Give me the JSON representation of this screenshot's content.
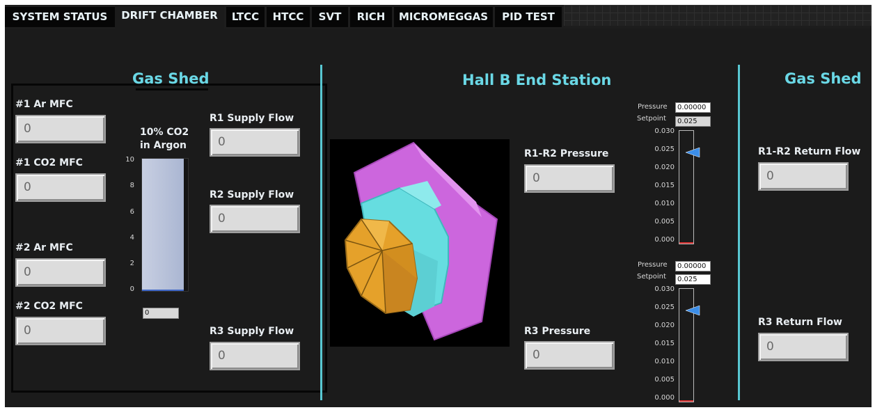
{
  "tabs": [
    "SYSTEM STATUS",
    "DRIFT CHAMBER",
    "LTCC",
    "HTCC",
    "SVT",
    "RICH",
    "MICROMEGGAS",
    "PID TEST"
  ],
  "active_tab": "DRIFT CHAMBER",
  "left_panel": {
    "title": "Gas Shed",
    "mfc": [
      {
        "label": "#1 Ar MFC",
        "value": "0"
      },
      {
        "label": "#1 CO2 MFC",
        "value": "0"
      },
      {
        "label": "#2 Ar MFC",
        "value": "0"
      },
      {
        "label": "#2 CO2 MFC",
        "value": "0"
      }
    ],
    "tank": {
      "label_line1": "10% CO2",
      "label_line2": "in Argon",
      "scale": [
        "10",
        "8",
        "6",
        "4",
        "2",
        "0"
      ],
      "level": 1.0,
      "readout": "0"
    },
    "supply": [
      {
        "label": "R1 Supply Flow",
        "value": "0"
      },
      {
        "label": "R2 Supply Flow",
        "value": "0"
      },
      {
        "label": "R3 Supply Flow",
        "value": "0"
      }
    ]
  },
  "center_panel": {
    "title": "Hall B End Station",
    "pressures": [
      {
        "label": "R1-R2 Pressure",
        "value": "0"
      },
      {
        "label": "R3 Pressure",
        "value": "0"
      }
    ],
    "gauges": [
      {
        "pressure_label": "Pressure",
        "pressure_value": "0.00000",
        "setpoint_label": "Setpoint",
        "setpoint_value": "0.025",
        "scale": [
          "0.030",
          "0.025",
          "0.020",
          "0.015",
          "0.010",
          "0.005",
          "0.000"
        ],
        "setpoint_marker": 0.025,
        "max": 0.03
      },
      {
        "pressure_label": "Pressure",
        "pressure_value": "0.00000",
        "setpoint_label": "Setpoint",
        "setpoint_value": "0.025",
        "scale": [
          "0.030",
          "0.025",
          "0.020",
          "0.015",
          "0.010",
          "0.005",
          "0.000"
        ],
        "setpoint_marker": 0.025,
        "max": 0.03
      }
    ]
  },
  "right_panel": {
    "title": "Gas Shed",
    "returns": [
      {
        "label": "R1-R2 Return Flow",
        "value": "0"
      },
      {
        "label": "R3 Return Flow",
        "value": "0"
      }
    ]
  },
  "colors": {
    "accent": "#58c7d2",
    "detector_magenta": "#cc66dd",
    "detector_cyan": "#66dde0",
    "detector_orange": "#e5a12a",
    "tank_fill": "#b5c0d8"
  }
}
